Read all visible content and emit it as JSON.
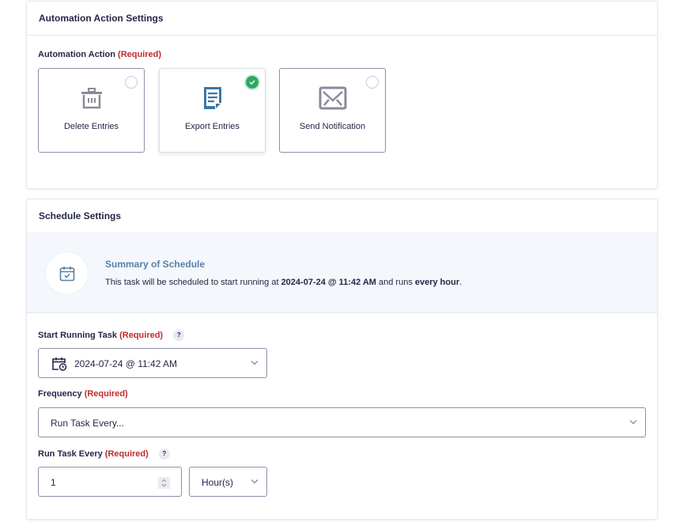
{
  "action_card": {
    "title": "Automation Action Settings",
    "field_label": "Automation Action",
    "required": "(Required)",
    "options": [
      {
        "label": "Delete Entries",
        "icon": "trash-icon",
        "selected": false
      },
      {
        "label": "Export Entries",
        "icon": "document-icon",
        "selected": true
      },
      {
        "label": "Send Notification",
        "icon": "envelope-icon",
        "selected": false
      }
    ]
  },
  "schedule_card": {
    "title": "Schedule Settings",
    "summary": {
      "title": "Summary of Schedule",
      "text_prefix": "This task will be scheduled to start running at ",
      "start": "2024-07-24 @ 11:42 AM",
      "text_mid": " and runs ",
      "frequency": "every hour",
      "text_suffix": "."
    },
    "start_task": {
      "label": "Start Running Task",
      "required": "(Required)",
      "help": "?",
      "value": "2024-07-24 @ 11:42 AM"
    },
    "frequency": {
      "label": "Frequency",
      "required": "(Required)",
      "value": "Run Task Every..."
    },
    "run_every": {
      "label": "Run Task Every",
      "required": "(Required)",
      "help": "?",
      "number": "1",
      "unit": "Hour(s)"
    }
  },
  "colors": {
    "required": "#c02b2b",
    "selected_check": "#2da862",
    "summary_title": "#5780a6",
    "export_icon": "#3a78a8"
  }
}
